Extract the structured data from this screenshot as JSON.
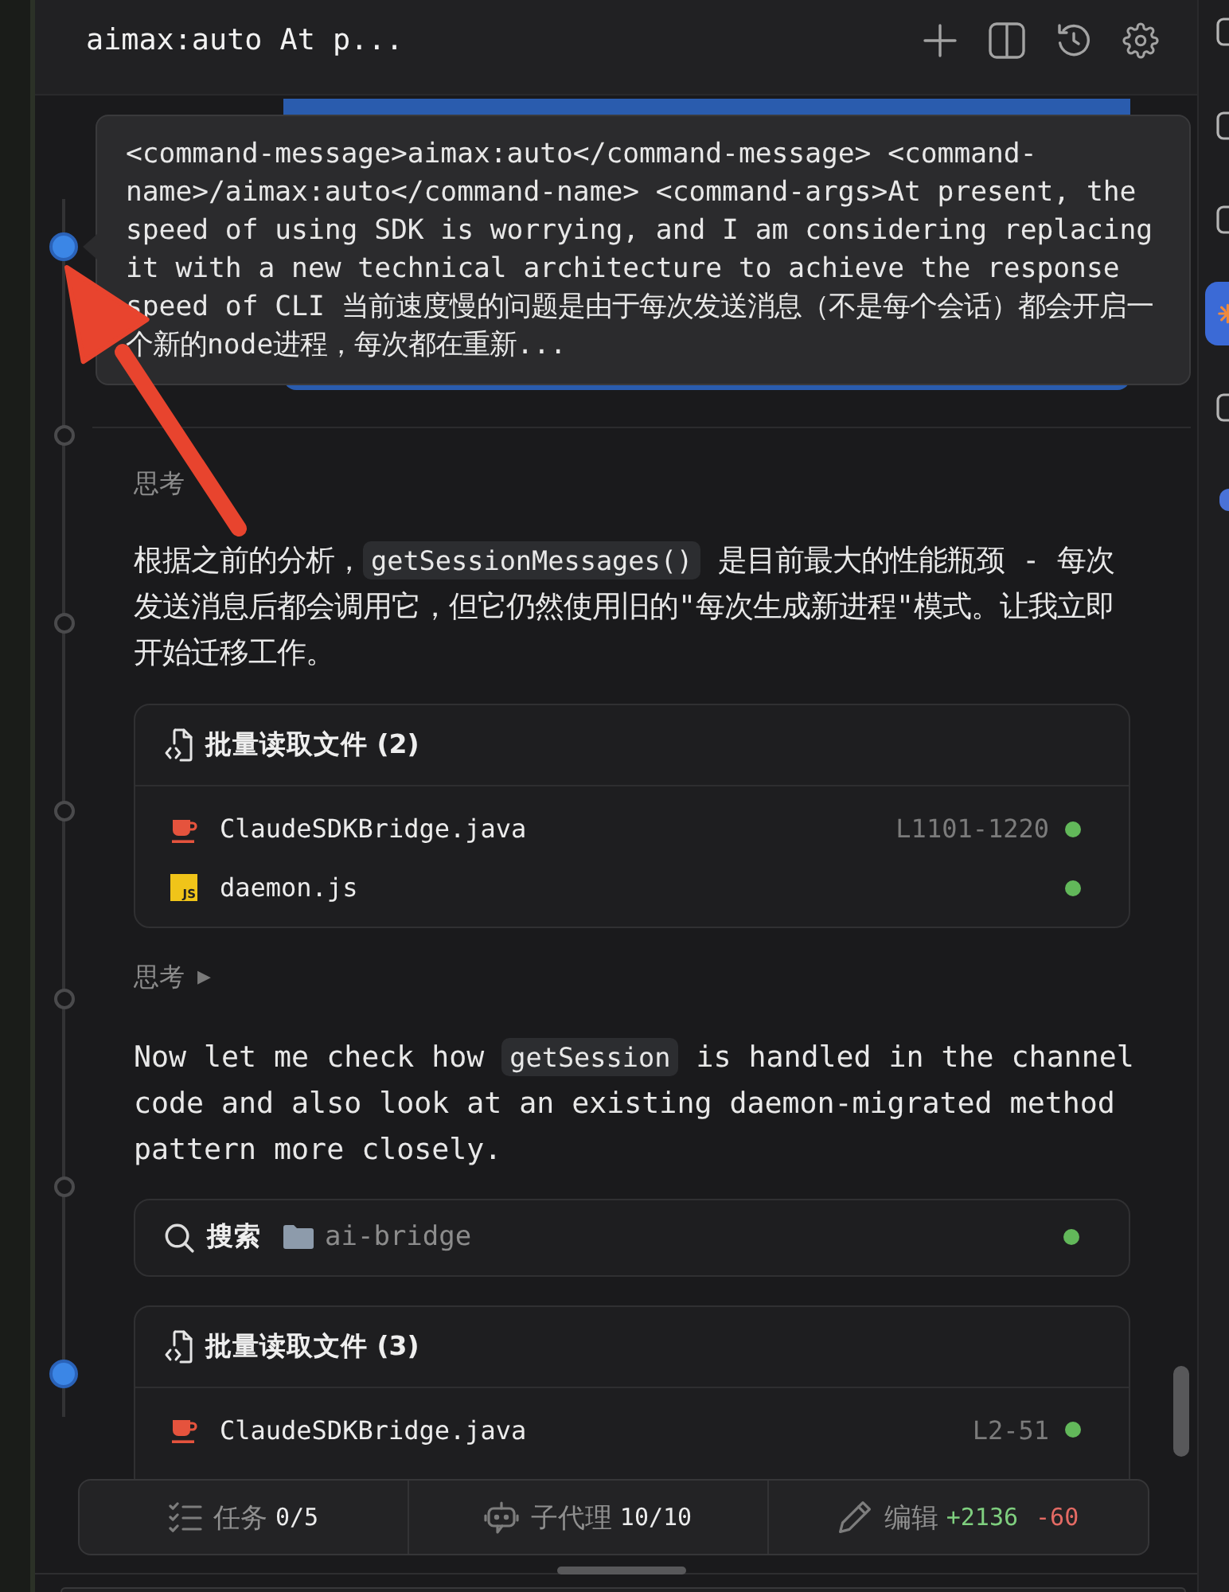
{
  "header": {
    "title": "aimax:auto At p..."
  },
  "sidebar": {
    "items": [
      {
        "selected": false
      },
      {
        "selected": false
      },
      {
        "selected": false
      },
      {
        "selected": true
      },
      {
        "selected": false
      }
    ]
  },
  "timeline": {
    "nodes": [
      {
        "selected": true
      },
      {
        "selected": false
      },
      {
        "selected": false
      },
      {
        "selected": false
      },
      {
        "selected": false
      },
      {
        "selected": false
      },
      {
        "selected": true
      }
    ]
  },
  "tooltip": {
    "text": "<command-message>aimax:auto</command-message> <command-name>/aimax:auto</command-name> <command-args>At present, the speed of using SDK is worrying, and I am considering replacing it with a new technical architecture to achieve the response speed of CLI 当前速度慢的问题是由于每次发送消息（不是每个会话）都会开启一个新的node进程，每次都在重新..."
  },
  "messages": [
    {
      "kind": "thinking",
      "label": "思考"
    },
    {
      "kind": "paragraph",
      "segments": [
        {
          "kind": "text",
          "text": "根据之前的分析，"
        },
        {
          "kind": "code",
          "text": "getSessionMessages()"
        },
        {
          "kind": "text",
          "text": " 是目前最大的性能瓶颈 - 每次发送消息后都会调用它，但它仍然使用旧的\"每次生成新进程\"模式。让我立即开始迁移工作。"
        }
      ]
    },
    {
      "kind": "batch_read",
      "title": "批量读取文件 (2)",
      "files": [
        {
          "kind": "java",
          "name": "ClaudeSDKBridge.java",
          "range": "L1101-1220",
          "done": true
        },
        {
          "kind": "js",
          "icon_label": "JS",
          "name": "daemon.js",
          "done": true
        }
      ]
    },
    {
      "kind": "thinking",
      "label": "思考",
      "caret": "▶"
    },
    {
      "kind": "paragraph",
      "segments": [
        {
          "kind": "text",
          "text": "Now let me check how "
        },
        {
          "kind": "code",
          "text": "getSession"
        },
        {
          "kind": "text",
          "text": " is handled in the channel code and also look at an existing daemon-migrated method pattern more closely."
        }
      ]
    },
    {
      "kind": "search",
      "label": "搜索",
      "path": "ai-bridge",
      "done": true
    },
    {
      "kind": "batch_read",
      "title": "批量读取文件 (3)",
      "files": [
        {
          "kind": "java",
          "name": "ClaudeSDKBridge.java",
          "range": "L2-51",
          "done": true
        }
      ]
    }
  ],
  "status_bar": {
    "items": [
      {
        "kind": "tasks",
        "label": "任务",
        "value": "0/5"
      },
      {
        "kind": "subagents",
        "label": "子代理",
        "value": "10/10"
      },
      {
        "kind": "edits",
        "label": "编辑",
        "added": "+2136",
        "removed": "-60"
      }
    ]
  }
}
